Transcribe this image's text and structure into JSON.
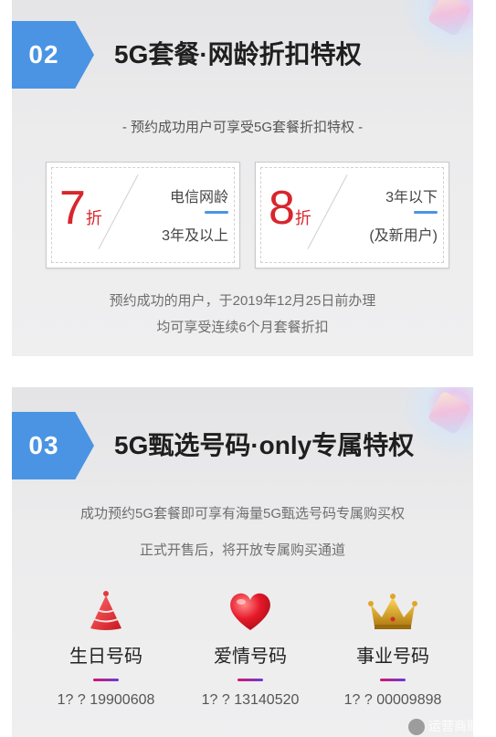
{
  "section2": {
    "number": "02",
    "title": "5G套餐·网龄折扣特权",
    "subtitle": "- 预约成功用户可享受5G套餐折扣特权 -",
    "cards": [
      {
        "value": "7",
        "unit": "折",
        "line1": "电信网龄",
        "line2": "3年及以上"
      },
      {
        "value": "8",
        "unit": "折",
        "line1": "3年以下",
        "line2": "(及新用户)"
      }
    ],
    "notice_line1": "预约成功的用户，于2019年12月25日前办理",
    "notice_line2": "均可享受连续6个月套餐折扣"
  },
  "section3": {
    "number": "03",
    "title": "5G甄选号码·only专属特权",
    "desc_line1": "成功预约5G套餐即可享有海量5G甄选号码专属购买权",
    "desc_line2": "正式开售后，将开放专属购买通道",
    "numbers": [
      {
        "icon": "party-hat-icon",
        "label": "生日号码",
        "value": "1? ? 19900608"
      },
      {
        "icon": "heart-icon",
        "label": "爱情号码",
        "value": "1? ? 13140520"
      },
      {
        "icon": "crown-icon",
        "label": "事业号码",
        "value": "1? ? 00009898"
      }
    ]
  },
  "watermark": "运营商财经",
  "colors": {
    "accent_blue": "#4a94e3",
    "discount_red": "#d8262d"
  }
}
